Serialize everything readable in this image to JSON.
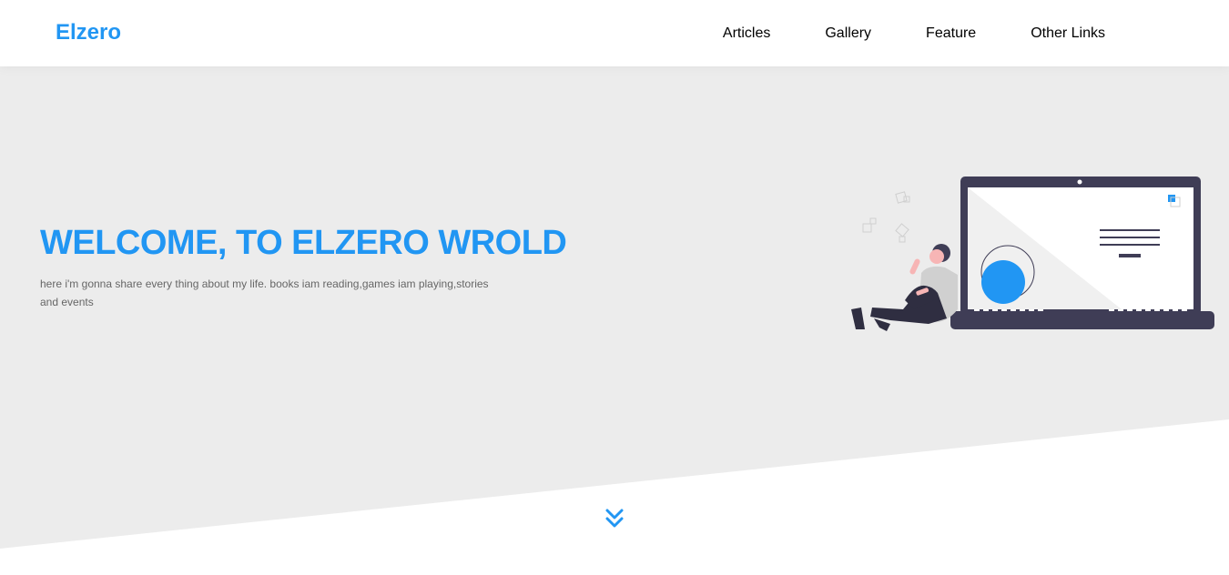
{
  "header": {
    "logo": "Elzero",
    "nav": [
      {
        "label": "Articles"
      },
      {
        "label": "Gallery"
      },
      {
        "label": "Feature"
      },
      {
        "label": "Other Links"
      }
    ]
  },
  "landing": {
    "title": "WELCOME, TO ELZERO WROLD",
    "description": "here i'm gonna share every thing about my life. books iam reading,games iam playing,stories and events",
    "illustration": "person-with-laptop-illustration",
    "go_down_icon": "double-chevron-down-icon"
  },
  "colors": {
    "accent": "#2196f3",
    "landing_background": "#ececec",
    "laptop": "#3f3d56",
    "text_muted": "#666666"
  }
}
